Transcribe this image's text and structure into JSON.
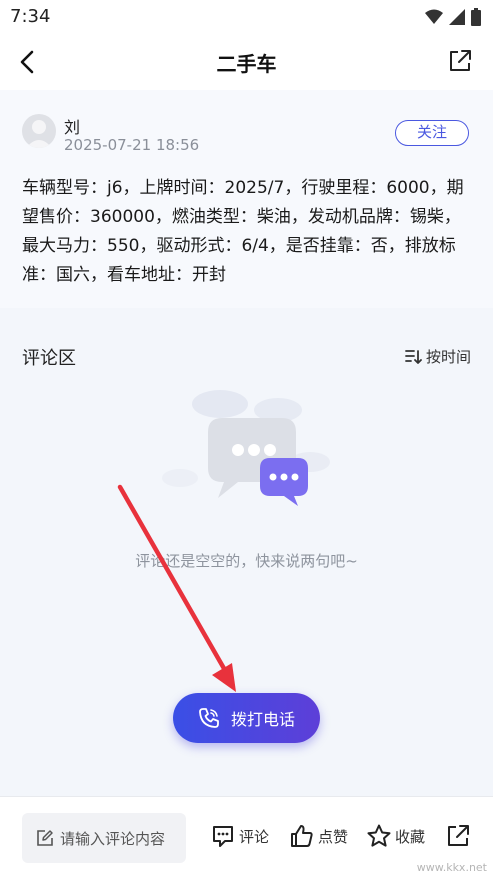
{
  "status_bar": {
    "time": "7:34",
    "icons": [
      "wifi-icon",
      "signal-icon",
      "battery-icon"
    ]
  },
  "app_bar": {
    "title": "二手车",
    "back_icon": "back-arrow-icon",
    "share_icon": "share-external-icon"
  },
  "post": {
    "author": "刘",
    "date": "2025-07-21 18:56",
    "follow_label": "关注",
    "content": "车辆型号：j6，上牌时间：2025/7，行驶里程：6000，期望售价：360000，燃油类型：柴油，发动机品牌：锡柴，最大马力：550，驱动形式：6/4，是否挂靠：否，排放标准：国六，看车地址：开封"
  },
  "comments": {
    "title": "评论区",
    "sort_label": "按时间",
    "empty_text": "评论还是空空的，快来说两句吧~"
  },
  "call_button": {
    "label": "拨打电话"
  },
  "bottom_bar": {
    "input_placeholder": "请输入评论内容",
    "comment_label": "评论",
    "like_label": "点赞",
    "favorite_label": "收藏"
  },
  "watermark": "www.kkx.net",
  "colors": {
    "accent": "#4a58e0",
    "call_gradient_start": "#3a4fe6",
    "call_gradient_end": "#5d3fd8",
    "annotation_arrow": "#e8323c",
    "content_bg": "#f3f6fb"
  }
}
